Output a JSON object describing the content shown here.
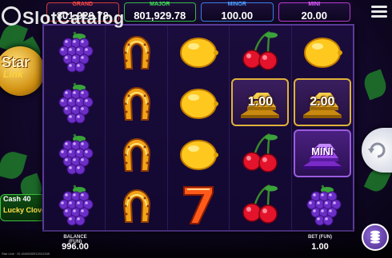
{
  "watermark": {
    "text": "SlotCatalog"
  },
  "jackpots": [
    {
      "label": "GRAND",
      "value": "801,929.78",
      "color": "#ff4a4a"
    },
    {
      "label": "MAJOR",
      "value": "801,929.78",
      "color": "#3fe05a"
    },
    {
      "label": "MINOR",
      "value": "100.00",
      "color": "#4fa0ff"
    },
    {
      "label": "MINI",
      "value": "20.00",
      "color": "#e060ff"
    }
  ],
  "logo": {
    "word": "Star",
    "sub": "Link",
    "badge_line1": "Cash 40",
    "badge_line2": "Lucky Clover"
  },
  "reels": [
    [
      "grapes",
      "grapes",
      "grapes",
      "grapes"
    ],
    [
      "horseshoe",
      "horseshoe",
      "horseshoe",
      "horseshoe"
    ],
    [
      "lemon",
      "lemon",
      "lemon",
      "seven"
    ],
    [
      "cherry",
      "gold-bars",
      "cherry",
      "cherry"
    ],
    [
      "lemon",
      "gold-bars",
      "mini-bars",
      "grapes"
    ]
  ],
  "bonus_values": {
    "reel4_row2": "1.00",
    "reel5_row2": "2.00",
    "reel5_row3": "MINI"
  },
  "balance": {
    "label": "BALANCE (FUN)",
    "value": "996.00"
  },
  "bet": {
    "label": "BET (FUN)",
    "value": "1.00"
  },
  "footer": {
    "text": "Star Link · ID 4040630912012345"
  },
  "colors": {
    "gold": "#e0b23a",
    "background": "#14092e"
  }
}
